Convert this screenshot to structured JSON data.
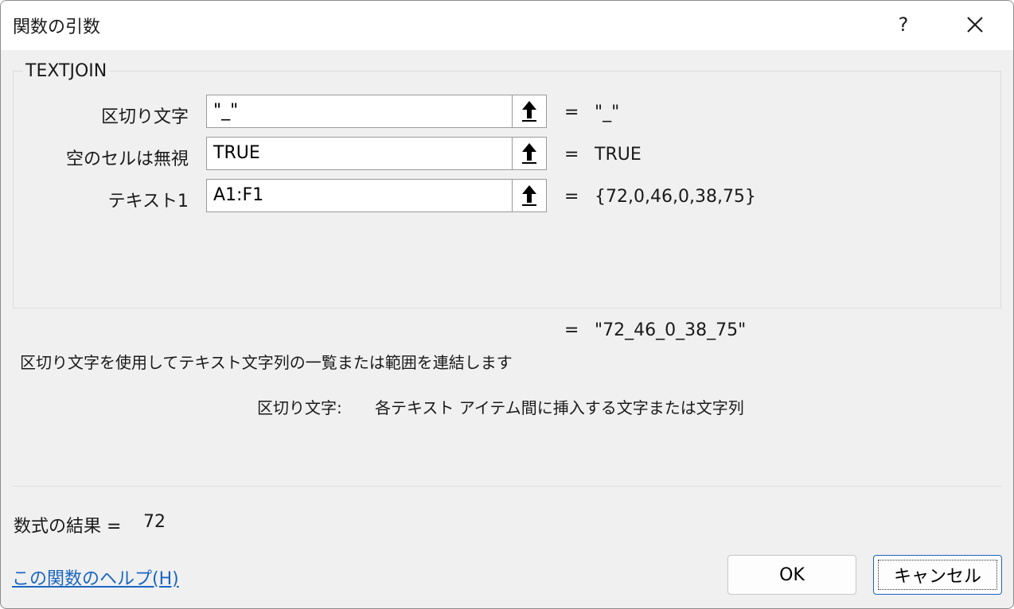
{
  "window": {
    "title": "関数の引数",
    "help_label": "?",
    "close_icon": "close-icon"
  },
  "function_name": "TEXTJOIN",
  "arguments": [
    {
      "label": "区切り文字",
      "input": "\"_\"",
      "equals": "=",
      "value": "\"_\""
    },
    {
      "label": "空のセルは無視",
      "input": "TRUE",
      "equals": "=",
      "value": "TRUE"
    },
    {
      "label": "テキスト1",
      "input": "A1:F1",
      "equals": "=",
      "value": "{72,0,46,0,38,75}"
    }
  ],
  "result": {
    "equals": "=",
    "value": "\"72_46_0_38_75\""
  },
  "description": "区切り文字を使用してテキスト文字列の一覧または範囲を連結します",
  "argument_help": {
    "label": "区切り文字:",
    "text": "各テキスト アイテム間に挿入する文字または文字列"
  },
  "formula_result": {
    "label": "数式の結果 =",
    "value": "72"
  },
  "help_link": "この関数のヘルプ(H)",
  "buttons": {
    "ok": "OK",
    "cancel": "キャンセル"
  },
  "colors": {
    "link": "#1a66c2",
    "accent_border": "#1a66c2",
    "background": "#f0f0f0"
  }
}
